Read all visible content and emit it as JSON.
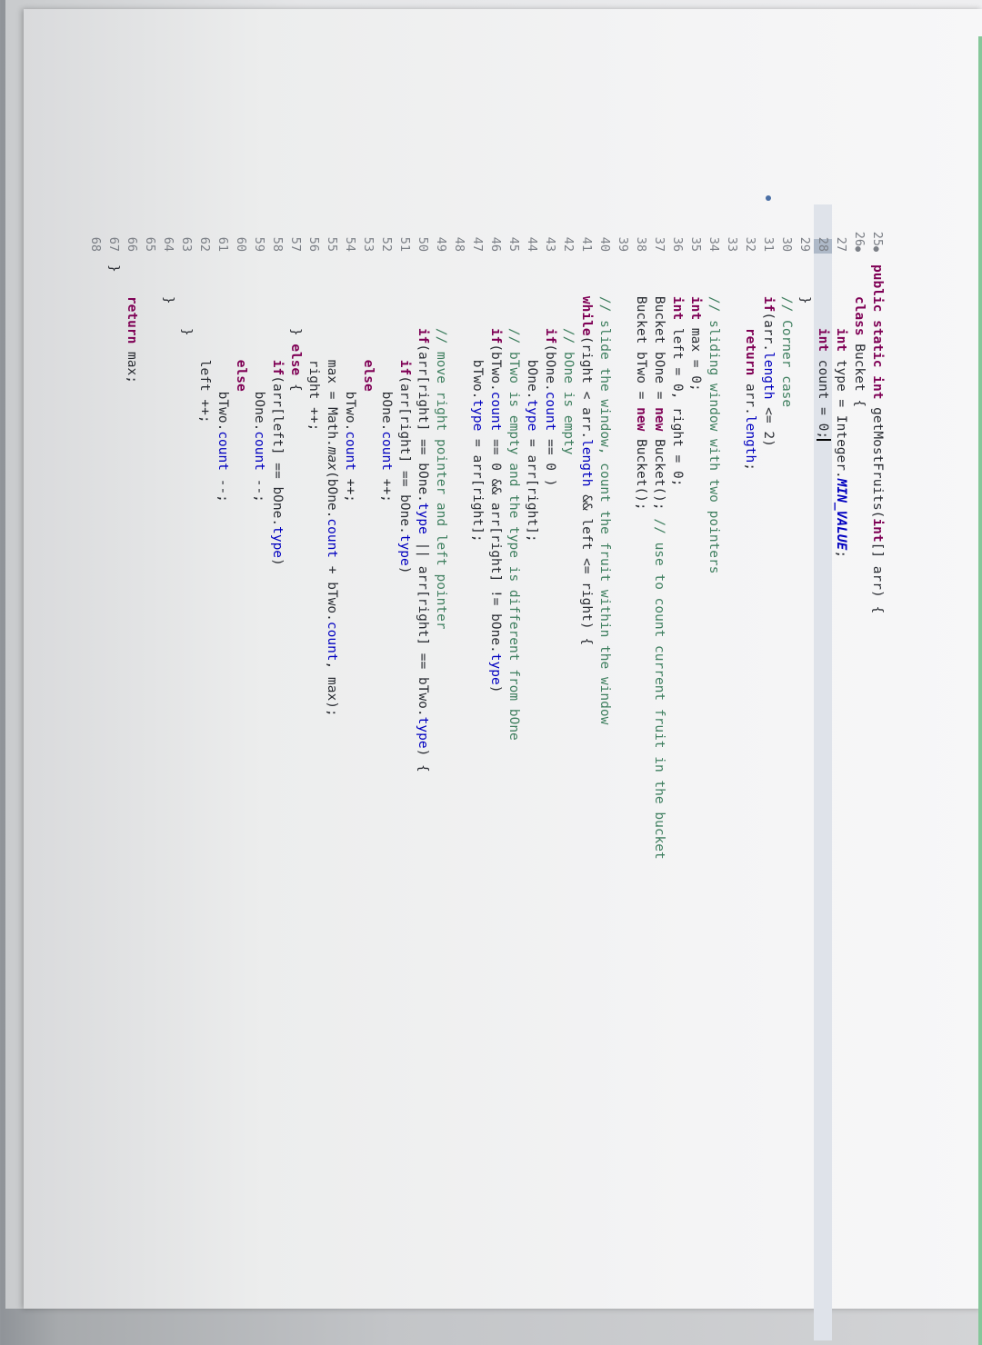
{
  "editor": {
    "lines": [
      {
        "num": "25",
        "fold": true,
        "text": "public static int getMostFruits(int[] arr) {"
      },
      {
        "num": "26",
        "fold": true,
        "text": "    class Bucket {"
      },
      {
        "num": "27",
        "text": "        int type = Integer.MIN_VALUE;"
      },
      {
        "num": "28",
        "highlight": true,
        "text": "        int count = 0;"
      },
      {
        "num": "29",
        "text": "    }"
      },
      {
        "num": "30",
        "text": "    // Corner case"
      },
      {
        "num": "31",
        "marker": true,
        "text": "    if(arr.length <= 2)"
      },
      {
        "num": "32",
        "text": "        return arr.length;"
      },
      {
        "num": "33",
        "text": ""
      },
      {
        "num": "34",
        "text": "    // sliding window with two pointers"
      },
      {
        "num": "35",
        "text": "    int max = 0;"
      },
      {
        "num": "36",
        "text": "    int left = 0, right = 0;"
      },
      {
        "num": "37",
        "text": "    Bucket bOne = new Bucket(); // use to count current fruit in the bucket"
      },
      {
        "num": "38",
        "text": "    Bucket bTwo = new Bucket();"
      },
      {
        "num": "39",
        "text": ""
      },
      {
        "num": "40",
        "text": "    // slide the window, count the fruit within the window"
      },
      {
        "num": "41",
        "text": "    while(right < arr.length && left <= right) {"
      },
      {
        "num": "42",
        "text": "        // bOne is empty"
      },
      {
        "num": "43",
        "text": "        if(bOne.count == 0 )"
      },
      {
        "num": "44",
        "text": "            bOne.type = arr[right];"
      },
      {
        "num": "45",
        "text": "        // bTwo is empty and the type is different from bOne"
      },
      {
        "num": "46",
        "text": "        if(bTwo.count == 0 && arr[right] != bOne.type)"
      },
      {
        "num": "47",
        "text": "            bTwo.type = arr[right];"
      },
      {
        "num": "48",
        "text": ""
      },
      {
        "num": "49",
        "text": "        // move right pointer and left pointer"
      },
      {
        "num": "50",
        "text": "        if(arr[right] == bOne.type || arr[right] == bTwo.type) {"
      },
      {
        "num": "51",
        "text": "            if(arr[right] == bOne.type)"
      },
      {
        "num": "52",
        "text": "                bOne.count ++;"
      },
      {
        "num": "53",
        "text": "            else"
      },
      {
        "num": "54",
        "text": "                bTwo.count ++;"
      },
      {
        "num": "55",
        "text": "            max = Math.max(bOne.count + bTwo.count, max);"
      },
      {
        "num": "56",
        "text": "            right ++;"
      },
      {
        "num": "57",
        "text": "        } else {"
      },
      {
        "num": "58",
        "text": "            if(arr[left] == bOne.type)"
      },
      {
        "num": "59",
        "text": "                bOne.count --;"
      },
      {
        "num": "60",
        "text": "            else"
      },
      {
        "num": "61",
        "text": "                bTwo.count --;"
      },
      {
        "num": "62",
        "text": "            left ++;"
      },
      {
        "num": "63",
        "text": "        }"
      },
      {
        "num": "64",
        "text": "    }"
      },
      {
        "num": "65",
        "text": ""
      },
      {
        "num": "66",
        "text": "    return max;"
      },
      {
        "num": "67",
        "text": "}"
      },
      {
        "num": "68",
        "text": ""
      }
    ]
  },
  "colors": {
    "keyword": "#7f0055",
    "comment": "#3f7f5f",
    "field": "#0000c0",
    "line_highlight": "#dfe3ea",
    "accent_rule": "#86c79a"
  }
}
